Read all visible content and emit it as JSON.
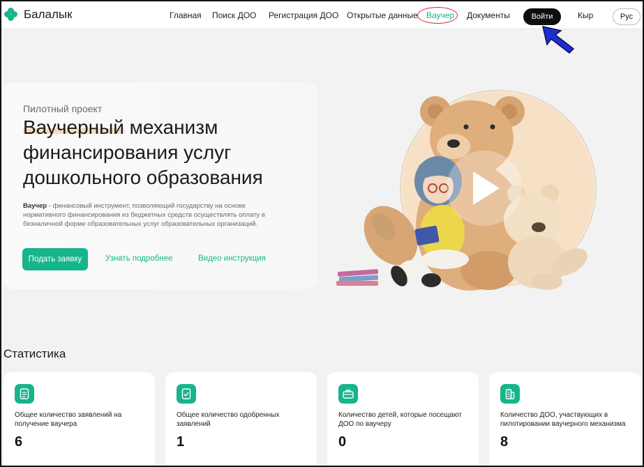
{
  "header": {
    "logo_text": "Балалык",
    "nav": [
      {
        "id": "home",
        "label": "Главная"
      },
      {
        "id": "search",
        "label": "Поиск ДОО"
      },
      {
        "id": "registration",
        "label": "Регистрация ДОО"
      },
      {
        "id": "open-data",
        "label": "Открытые данные"
      },
      {
        "id": "voucher",
        "label": "Ваучер"
      },
      {
        "id": "documents",
        "label": "Документы"
      }
    ],
    "login_label": "Войти",
    "lang_kyr": "Кыр",
    "lang_rus": "Рус"
  },
  "hero": {
    "eyebrow": "Пилотный проект",
    "title_highlight": "Ваучерный",
    "title_rest": " механизм финансирования услуг дошкольного образования",
    "desc_bold": "Ваучер",
    "desc_rest": " - финансовый инструмент, позволяющий государству на основе нормативного финансирования из бюджетных средств осуществлять оплату в безналичной форме образовательных услуг образовательных организаций.",
    "apply_label": "Подать заявку",
    "learn_more_label": "Узнать подробнее",
    "video_label": "Видео инструкция"
  },
  "stats": {
    "title": "Статистика",
    "cards": [
      {
        "label": "Общее количество заявлений на получение ваучера",
        "value": "6",
        "icon": "document-icon"
      },
      {
        "label": "Общее количество одобренных заявлений",
        "value": "1",
        "icon": "checklist-icon"
      },
      {
        "label": "Количество детей, которые посещают ДОО по ваучеру",
        "value": "0",
        "icon": "briefcase-icon"
      },
      {
        "label": "Количество ДОО, участвующих в пилотировании ваучерного механизма",
        "value": "8",
        "icon": "building-icon"
      }
    ]
  },
  "colors": {
    "accent": "#17b58c",
    "annotation_circle": "#d72b2b",
    "login_bg": "#0d0d0d"
  }
}
